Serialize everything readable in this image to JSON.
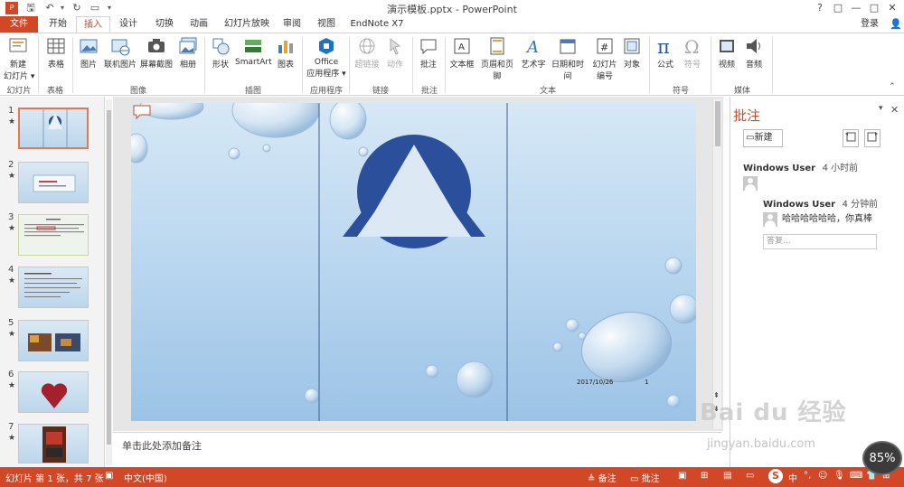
{
  "window": {
    "title": "演示模板.pptx - PowerPoint",
    "controls": {
      "help": "?",
      "restore": "□",
      "minimize": "—",
      "maximize": "□",
      "close": "✕"
    }
  },
  "tabs": [
    "文件",
    "开始",
    "插入",
    "设计",
    "切换",
    "动画",
    "幻灯片放映",
    "审阅",
    "视图",
    "EndNote X7"
  ],
  "active_tab": "插入",
  "login_label": "登录",
  "ribbon": {
    "buttons": [
      {
        "id": "new-slide",
        "label": "新建\n幻灯片 ▾",
        "icon": "new-slide-icon"
      },
      {
        "id": "table",
        "label": "表格",
        "icon": "table-icon"
      },
      {
        "id": "picture",
        "label": "图片",
        "icon": "picture-icon"
      },
      {
        "id": "online-picture",
        "label": "联机图片",
        "icon": "online-picture-icon"
      },
      {
        "id": "screenshot",
        "label": "屏幕截图",
        "icon": "screenshot-icon"
      },
      {
        "id": "album",
        "label": "相册",
        "icon": "album-icon"
      },
      {
        "id": "shapes",
        "label": "形状",
        "icon": "shapes-icon"
      },
      {
        "id": "smartart",
        "label": "SmartArt",
        "icon": "smartart-icon"
      },
      {
        "id": "chart",
        "label": "图表",
        "icon": "chart-icon"
      },
      {
        "id": "office-apps",
        "label": "Office\n应用程序 ▾",
        "icon": "office-icon"
      },
      {
        "id": "hyperlink",
        "label": "超链接",
        "icon": "hyperlink-icon",
        "disabled": true
      },
      {
        "id": "action",
        "label": "动作",
        "icon": "action-icon",
        "disabled": true
      },
      {
        "id": "comment",
        "label": "批注",
        "icon": "comment-icon"
      },
      {
        "id": "textbox",
        "label": "文本框",
        "icon": "textbox-icon"
      },
      {
        "id": "header-footer",
        "label": "页眉和页脚",
        "icon": "header-footer-icon"
      },
      {
        "id": "wordart",
        "label": "艺术字",
        "icon": "wordart-icon"
      },
      {
        "id": "datetime",
        "label": "日期和时间",
        "icon": "calendar-icon"
      },
      {
        "id": "slide-number",
        "label": "幻灯片\n编号",
        "icon": "slide-number-icon"
      },
      {
        "id": "object",
        "label": "对象",
        "icon": "object-icon"
      },
      {
        "id": "equation",
        "label": "公式",
        "icon": "equation-icon"
      },
      {
        "id": "symbol",
        "label": "符号",
        "icon": "symbol-icon",
        "disabled": true
      },
      {
        "id": "video",
        "label": "视频",
        "icon": "video-icon"
      },
      {
        "id": "audio",
        "label": "音频",
        "icon": "audio-icon"
      }
    ],
    "groups": [
      "幻灯片",
      "表格",
      "图像",
      "插图",
      "应用程序",
      "链接",
      "批注",
      "文本",
      "符号",
      "媒体"
    ]
  },
  "slides": [
    {
      "number": "1",
      "star": "★",
      "selected": true
    },
    {
      "number": "2",
      "star": "★"
    },
    {
      "number": "3",
      "star": "★"
    },
    {
      "number": "4",
      "star": "★"
    },
    {
      "number": "5",
      "star": "★"
    },
    {
      "number": "6",
      "star": "★"
    },
    {
      "number": "7",
      "star": "★"
    }
  ],
  "slide_content": {
    "date": "2017/10/26",
    "page": "1"
  },
  "notes_placeholder": "单击此处添加备注",
  "comments": {
    "title": "批注",
    "new_label": "新建",
    "thread": [
      {
        "author": "Windows User",
        "time": "4 小时前",
        "text": ""
      },
      {
        "author": "Windows User",
        "time": "4 分钟前",
        "text": "哈哈哈哈哈哈，你真棒"
      }
    ],
    "reply_placeholder": "答复..."
  },
  "status": {
    "slide_info": "幻灯片 第 1 张，共 7 张",
    "language": "中文(中国)",
    "notes_btn": "备注",
    "comments_btn": "批注",
    "zoom": "85%"
  },
  "watermark": {
    "brand": "Bai du 经验",
    "url": "jingyan.baidu.com"
  },
  "colors": {
    "accent": "#d24726",
    "slide_bg": "#bcd6ec",
    "triangle": "#2c4f9c"
  }
}
